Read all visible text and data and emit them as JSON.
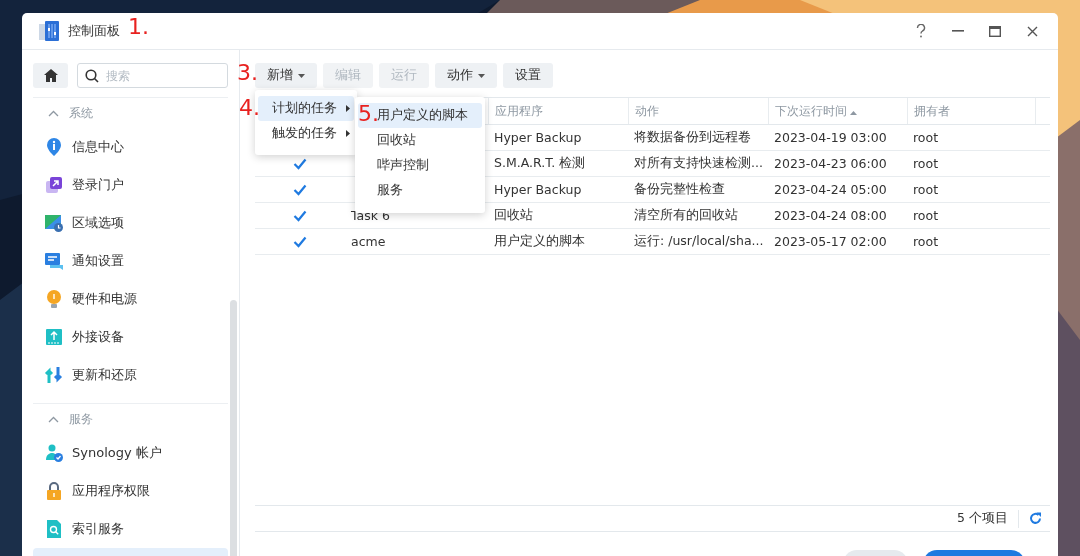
{
  "window": {
    "title": "控制面板"
  },
  "annotations": [
    {
      "text": "1."
    },
    {
      "text": "3."
    },
    {
      "text": "4."
    },
    {
      "text": "5."
    }
  ],
  "sidebar": {
    "search": {
      "placeholder": "搜索"
    },
    "sections": [
      {
        "label": "系统",
        "expanded": true,
        "items": [
          {
            "label": "信息中心",
            "selected": false
          },
          {
            "label": "登录门户",
            "selected": false
          },
          {
            "label": "区域选项",
            "selected": false
          },
          {
            "label": "通知设置",
            "selected": false
          },
          {
            "label": "硬件和电源",
            "selected": false
          },
          {
            "label": "外接设备",
            "selected": false
          },
          {
            "label": "更新和还原",
            "selected": false
          }
        ]
      },
      {
        "label": "服务",
        "expanded": true,
        "items": [
          {
            "label": "Synology 帐户",
            "selected": false
          },
          {
            "label": "应用程序权限",
            "selected": false
          },
          {
            "label": "索引服务",
            "selected": false
          },
          {
            "selected": true
          }
        ]
      }
    ]
  },
  "toolbar": {
    "buttons": [
      {
        "label": "新增",
        "dropdown": true,
        "disabled": false
      },
      {
        "label": "编辑",
        "dropdown": false,
        "disabled": true
      },
      {
        "label": "运行",
        "dropdown": false,
        "disabled": true
      },
      {
        "label": "动作",
        "dropdown": true,
        "disabled": false
      },
      {
        "label": "设置",
        "dropdown": false,
        "disabled": false
      }
    ]
  },
  "menu": {
    "items": [
      {
        "label": "计划的任务",
        "submenu": true,
        "selected": true
      },
      {
        "label": "触发的任务",
        "submenu": true,
        "selected": false
      }
    ]
  },
  "submenu": {
    "items": [
      {
        "label": "用户定义的脚本",
        "selected": true
      },
      {
        "label": "回收站",
        "selected": false
      },
      {
        "label": "哔声控制",
        "selected": false
      },
      {
        "label": "服务",
        "selected": false
      }
    ]
  },
  "table": {
    "columns": [
      {
        "label": "应用程序",
        "sorted": false
      },
      {
        "label": "动作",
        "sorted": false
      },
      {
        "label": "下次运行时间",
        "sorted": true
      },
      {
        "label": "拥有者",
        "sorted": false
      }
    ],
    "rows": [
      {
        "application": "Hyper Backup",
        "action": "将数据备份到远程卷",
        "next_run": "2023-04-19 03:00",
        "owner": "root"
      },
      {
        "enabled": true,
        "application": "S.M.A.R.T. 检测",
        "action": "对所有支持快速检测...",
        "next_run": "2023-04-23 06:00",
        "owner": "root"
      },
      {
        "enabled": true,
        "application": "Hyper Backup",
        "action": "备份完整性检查",
        "next_run": "2023-04-24 05:00",
        "owner": "root"
      },
      {
        "enabled": true,
        "name": "Task 6",
        "application": "回收站",
        "action": "清空所有的回收站",
        "next_run": "2023-04-24 08:00",
        "owner": "root"
      },
      {
        "enabled": true,
        "name": "acme",
        "application": "用户定义的脚本",
        "action": "运行: /usr/local/sha...",
        "next_run": "2023-05-17 02:00",
        "owner": "root"
      }
    ]
  },
  "status": {
    "count": "5 个项目"
  }
}
